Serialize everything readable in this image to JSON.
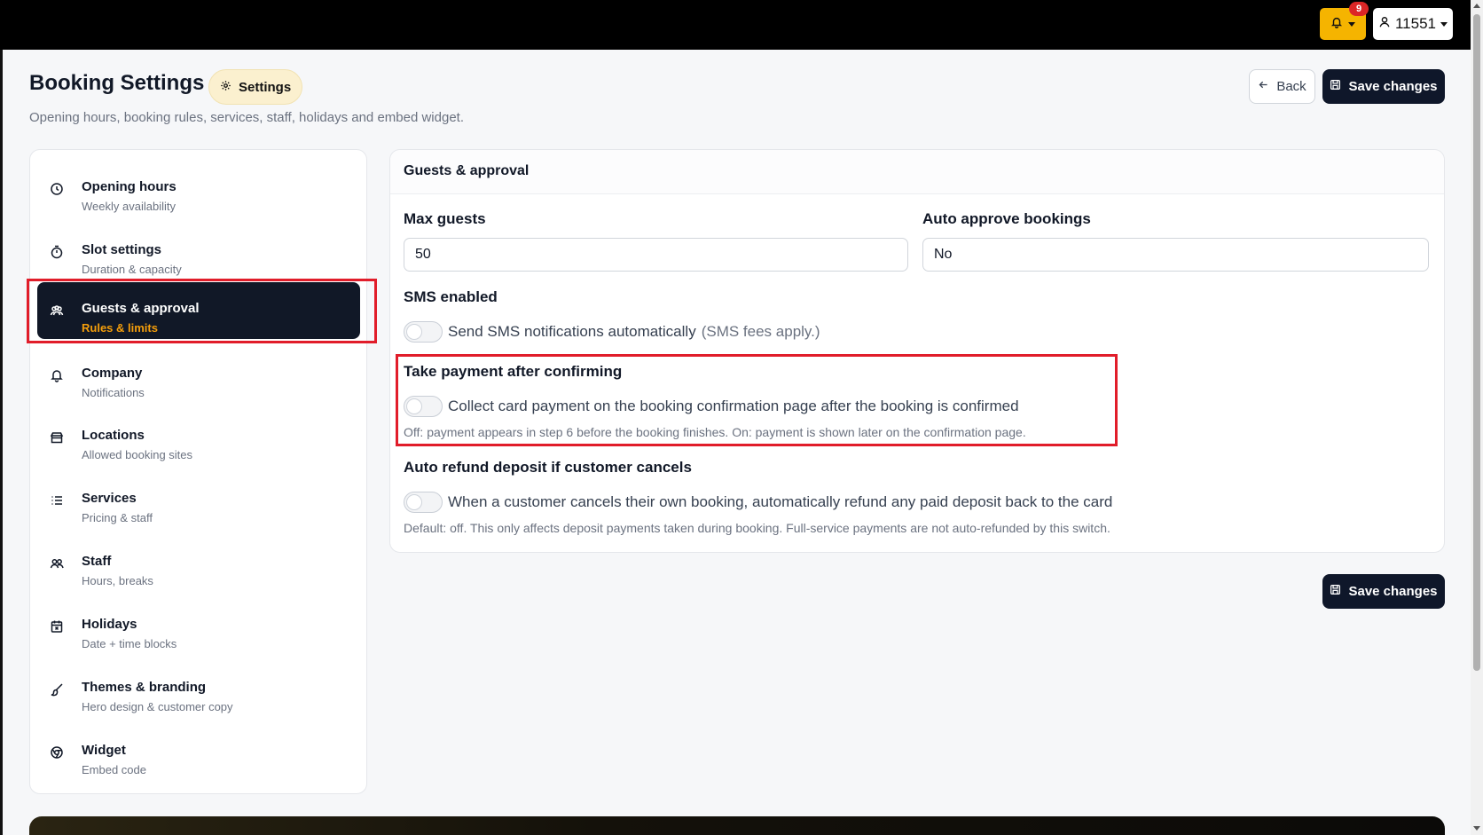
{
  "topbar": {
    "notification_count": "9",
    "user_label": "11551"
  },
  "header": {
    "title": "Booking Settings",
    "pill_label": "Settings",
    "subtitle": "Opening hours, booking rules, services, staff, holidays and embed widget.",
    "back_label": "Back",
    "save_label": "Save changes"
  },
  "sidebar": {
    "items": [
      {
        "title": "Opening hours",
        "subtitle": "Weekly availability",
        "icon": "clock-icon"
      },
      {
        "title": "Slot settings",
        "subtitle": "Duration & capacity",
        "icon": "timer-icon"
      },
      {
        "title": "Guests & approval",
        "subtitle": "Rules & limits",
        "icon": "users-icon",
        "active": true
      },
      {
        "title": "Company",
        "subtitle": "Notifications",
        "icon": "bell-icon"
      },
      {
        "title": "Locations",
        "subtitle": "Allowed booking sites",
        "icon": "store-icon"
      },
      {
        "title": "Services",
        "subtitle": "Pricing & staff",
        "icon": "list-icon"
      },
      {
        "title": "Staff",
        "subtitle": "Hours, breaks",
        "icon": "staff-icon"
      },
      {
        "title": "Holidays",
        "subtitle": "Date + time blocks",
        "icon": "calendar-x-icon"
      },
      {
        "title": "Themes & branding",
        "subtitle": "Hero design & customer copy",
        "icon": "brush-icon"
      },
      {
        "title": "Widget",
        "subtitle": "Embed code",
        "icon": "chrome-icon"
      }
    ]
  },
  "panel": {
    "title": "Guests & approval",
    "max_guests": {
      "label": "Max guests",
      "value": "50"
    },
    "auto_approve": {
      "label": "Auto approve bookings",
      "value": "No"
    },
    "sms": {
      "label": "SMS enabled",
      "toggle_text": "Send SMS notifications automatically",
      "toggle_note": "(SMS fees apply.)",
      "on": false
    },
    "payment": {
      "label": "Take payment after confirming",
      "toggle_text": "Collect card payment on the booking confirmation page after the booking is confirmed",
      "help": "Off: payment appears in step 6 before the booking finishes. On: payment is shown later on the confirmation page.",
      "on": false
    },
    "refund": {
      "label": "Auto refund deposit if customer cancels",
      "toggle_text": "When a customer cancels their own booking, automatically refund any paid deposit back to the card",
      "help": "Default: off. This only affects deposit payments taken during booking. Full-service payments are not auto-refunded by this switch.",
      "on": false
    }
  },
  "colors": {
    "accent": "#f5b400",
    "dark": "#0f172a",
    "active_subtitle": "#f59e0b",
    "highlight": "#e11d2a"
  }
}
